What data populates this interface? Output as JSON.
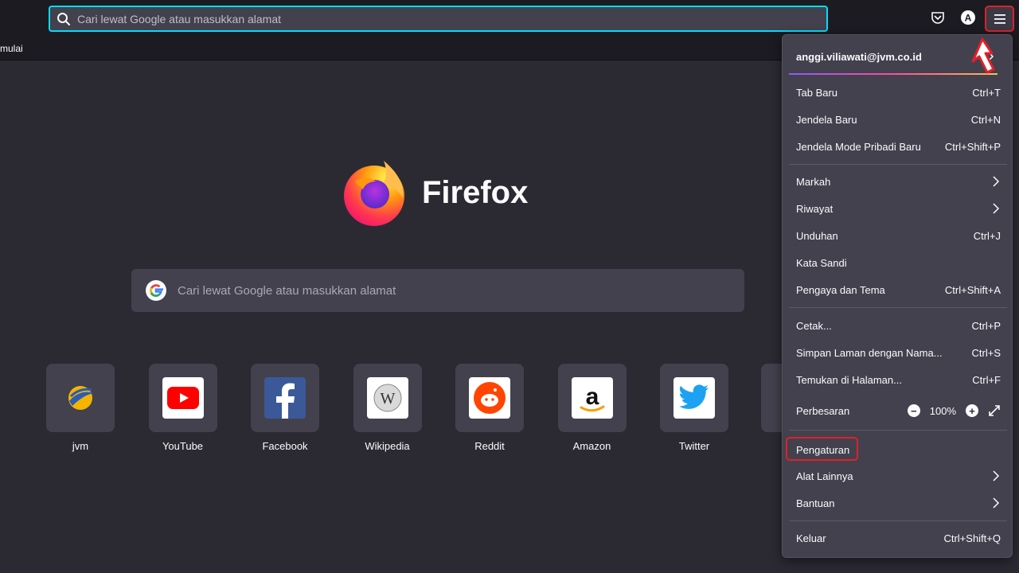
{
  "toolbar": {
    "url_placeholder": "Cari lewat Google atau masukkan alamat"
  },
  "bookmarks": {
    "item": "mulai"
  },
  "newtab": {
    "brand": "Firefox",
    "search_placeholder": "Cari lewat Google atau masukkan alamat",
    "tiles": [
      {
        "label": "jvm",
        "icon": "jvm-logo-icon"
      },
      {
        "label": "YouTube",
        "icon": "youtube-icon"
      },
      {
        "label": "Facebook",
        "icon": "facebook-icon"
      },
      {
        "label": "Wikipedia",
        "icon": "wikipedia-icon"
      },
      {
        "label": "Reddit",
        "icon": "reddit-icon"
      },
      {
        "label": "Amazon",
        "icon": "amazon-icon"
      },
      {
        "label": "Twitter",
        "icon": "twitter-icon"
      }
    ]
  },
  "menu": {
    "account": "anggi.viliawati@jvm.co.id",
    "items": [
      {
        "label": "Tab Baru",
        "shortcut": "Ctrl+T"
      },
      {
        "label": "Jendela Baru",
        "shortcut": "Ctrl+N"
      },
      {
        "label": "Jendela Mode Pribadi Baru",
        "shortcut": "Ctrl+Shift+P"
      },
      {
        "label": "Markah",
        "shortcut": ""
      },
      {
        "label": "Riwayat",
        "shortcut": ""
      },
      {
        "label": "Unduhan",
        "shortcut": "Ctrl+J"
      },
      {
        "label": "Kata Sandi",
        "shortcut": ""
      },
      {
        "label": "Pengaya dan Tema",
        "shortcut": "Ctrl+Shift+A"
      },
      {
        "label": "Cetak...",
        "shortcut": "Ctrl+P"
      },
      {
        "label": "Simpan Laman dengan Nama...",
        "shortcut": "Ctrl+S"
      },
      {
        "label": "Temukan di Halaman...",
        "shortcut": "Ctrl+F"
      },
      {
        "label": "Perbesaran",
        "shortcut": ""
      },
      {
        "label": "Pengaturan",
        "shortcut": ""
      },
      {
        "label": "Alat Lainnya",
        "shortcut": ""
      },
      {
        "label": "Bantuan",
        "shortcut": ""
      },
      {
        "label": "Keluar",
        "shortcut": "Ctrl+Shift+Q"
      }
    ],
    "zoom": {
      "minus": "−",
      "value": "100%",
      "plus": "+"
    }
  },
  "colors": {
    "accent": "#00ddff",
    "highlight": "#e0202b",
    "panel": "#42414d",
    "background": "#2b2a33"
  }
}
